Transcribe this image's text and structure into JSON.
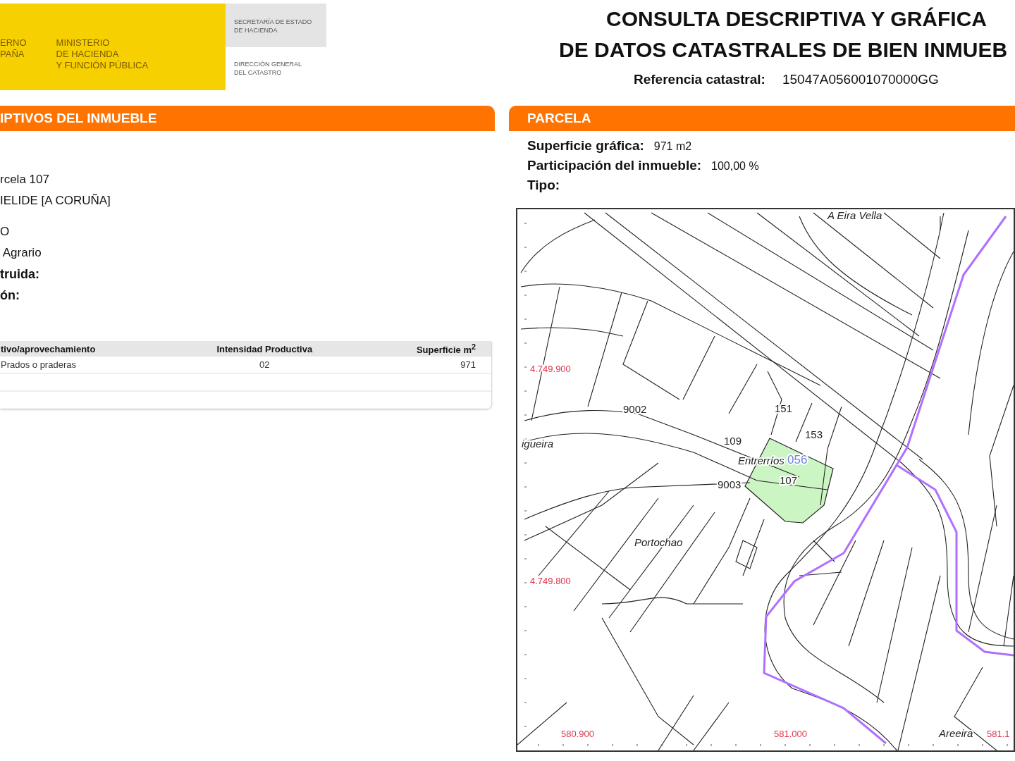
{
  "header": {
    "logo_left": [
      "ERNO",
      "PAÑA"
    ],
    "ministry": [
      "MINISTERIO",
      "DE HACIENDA",
      "Y FUNCIÓN PÚBLICA"
    ],
    "secretaria": [
      "SECRETARÍA DE ESTADO",
      "DE HACIENDA"
    ],
    "direccion": [
      "DIRECCIÓN GENERAL",
      "DEL CATASTRO"
    ],
    "title": [
      "CONSULTA DESCRIPTIVA Y GRÁFICA",
      "DE DATOS CATASTRALES DE BIEN INMUEB"
    ],
    "reference_label": "Referencia catastral:",
    "reference_value": "15047A056001070000GG"
  },
  "left_panel": {
    "title": "IPTIVOS DEL INMUEBLE",
    "lines": [
      {
        "text": "rcela 107",
        "kind": "value"
      },
      {
        "text": "IELIDE [A CORUÑA]",
        "kind": "value"
      },
      {
        "text": "O",
        "kind": "value"
      },
      {
        "text": " Agrario",
        "kind": "value"
      },
      {
        "text": "truida:",
        "kind": "label"
      },
      {
        "text": "ón:",
        "kind": "label"
      }
    ],
    "table": {
      "columns": [
        "tivo/aprovechamiento",
        "Intensidad Productiva",
        "Superficie m$^{2}$"
      ],
      "rows": [
        [
          "Prados o praderas",
          "02",
          "971"
        ]
      ]
    }
  },
  "right_panel": {
    "title": "PARCELA",
    "fields": [
      {
        "label": "Superficie gráfica:",
        "value": "971 m2"
      },
      {
        "label": "Participación del inmueble:",
        "value": "100,00 %"
      },
      {
        "label": "Tipo:"
      }
    ],
    "map": {
      "labels": [
        {
          "text": "A Eira Vella",
          "kind": "place"
        },
        {
          "text": "4.749.900",
          "kind": "coord"
        },
        {
          "text": "9002",
          "kind": "parcel"
        },
        {
          "text": "151",
          "kind": "parcel"
        },
        {
          "text": "153",
          "kind": "parcel"
        },
        {
          "text": "109",
          "kind": "parcel"
        },
        {
          "text": "igueira",
          "kind": "place"
        },
        {
          "text": "Entrerríos",
          "kind": "place"
        },
        {
          "text": "056",
          "kind": "polygon"
        },
        {
          "text": "107",
          "kind": "parcel"
        },
        {
          "text": "9003",
          "kind": "parcel"
        },
        {
          "text": "Portochao",
          "kind": "place"
        },
        {
          "text": "4.749.800",
          "kind": "coord"
        },
        {
          "text": "580.900",
          "kind": "coord"
        },
        {
          "text": "581.000",
          "kind": "coord"
        },
        {
          "text": "Areeira",
          "kind": "place"
        },
        {
          "text": "581.1",
          "kind": "coord"
        }
      ]
    }
  }
}
